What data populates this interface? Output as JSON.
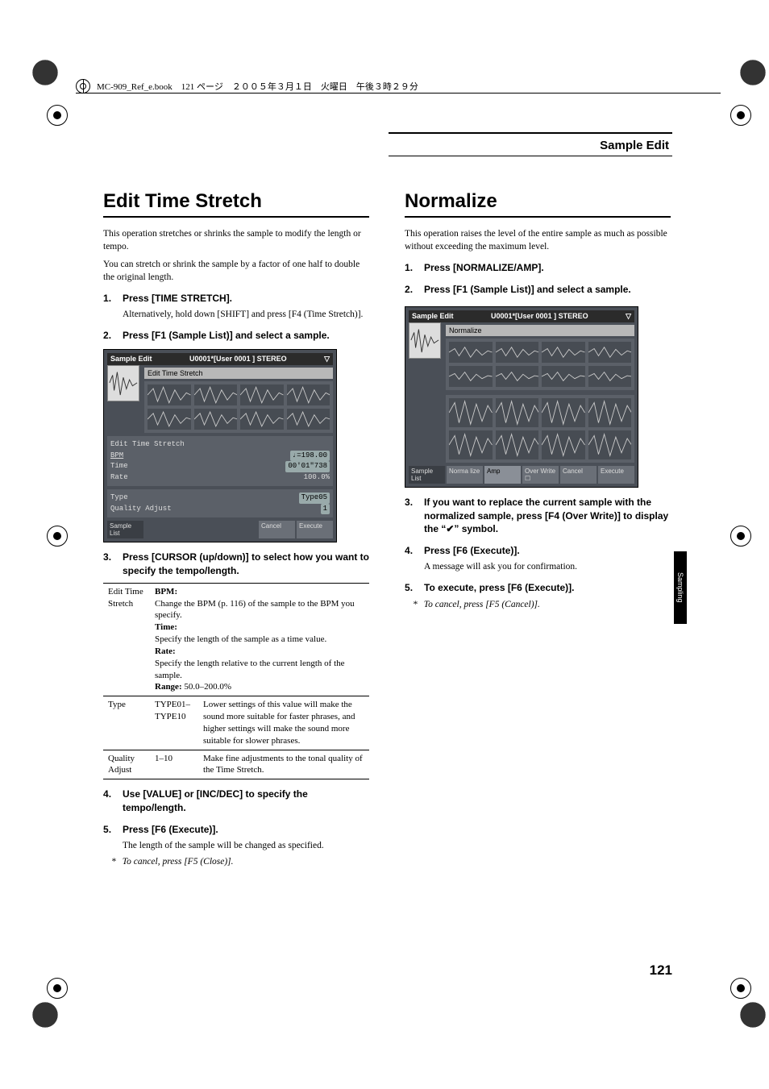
{
  "header": {
    "filebar": "MC-909_Ref_e.book　121 ページ　２００５年３月１日　火曜日　午後３時２９分"
  },
  "running_head": "Sample Edit",
  "side_tab": "Sampling",
  "page_number": "121",
  "left": {
    "title": "Edit Time Stretch",
    "intro_1": "This operation stretches or shrinks the sample to modify the length or tempo.",
    "intro_2": "You can stretch or shrink the sample by a factor of one half to double the original length.",
    "steps": {
      "1": "Press [TIME STRETCH].",
      "1_sub": "Alternatively, hold down [SHIFT] and press [F4 (Time Stretch)].",
      "2": "Press [F1 (Sample List)] and select a sample.",
      "3": "Press [CURSOR (up/down)] to select how you want to specify the tempo/length.",
      "4": "Use [VALUE] or [INC/DEC] to specify the tempo/length.",
      "5": "Press [F6 (Execute)].",
      "5_sub": "The length of the sample will be changed as specified.",
      "cancel": "To cancel, press [F5 (Close)]."
    },
    "screenshot": {
      "title_left": "Sample Edit",
      "title_mid": "U0001*[User 0001            ] STEREO",
      "subtitle": "Edit Time Stretch",
      "param_block_title": "Edit Time Stretch",
      "bpm_label": "BPM",
      "bpm_val": "♩=198.00",
      "time_label": "Time",
      "time_val": "00'01\"738",
      "rate_label": "Rate",
      "rate_val": "100.0%",
      "type_label": "Type",
      "type_val": "Type05",
      "qa_label": "Quality Adjust",
      "qa_val": "1",
      "sk1": "Sample List",
      "sk5": "Cancel",
      "sk6": "Execute"
    },
    "table": {
      "r1c1": "Edit Time Stretch",
      "r1c2_bpm": "BPM:",
      "r1c2_bpm_desc": "Change the BPM (p. 116) of the sample to the BPM you specify.",
      "r1c2_time": "Time:",
      "r1c2_time_desc": "Specify the length of the sample as a time value.",
      "r1c2_rate": "Rate:",
      "r1c2_rate_desc": "Specify the length relative to the current length of the sample.",
      "r1c2_range": "Range: ",
      "r1c2_range_val": "50.0–200.0%",
      "r2c1": "Type",
      "r2c2a": "TYPE01–TYPE10",
      "r2c2b": "Lower settings of this value will make the sound more suitable for faster phrases, and higher settings will make the sound more suitable for slower phrases.",
      "r3c1": "Quality Adjust",
      "r3c2a": "1–10",
      "r3c2b": "Make fine adjustments to the tonal quality of the Time Stretch."
    }
  },
  "right": {
    "title": "Normalize",
    "intro": "This operation raises the level of the entire sample as much as possible without exceeding the maximum level.",
    "steps": {
      "1": "Press [NORMALIZE/AMP].",
      "2": "Press [F1 (Sample List)] and select a sample.",
      "3": "If you want to replace the current sample with the normalized sample, press [F4 (Over Write)] to display the “✔” symbol.",
      "4": "Press [F6 (Execute)].",
      "4_sub": "A message will ask you for confirmation.",
      "5": "To execute, press [F6 (Execute)].",
      "cancel": "To cancel, press [F5 (Cancel)]."
    },
    "screenshot": {
      "title_left": "Sample Edit",
      "title_mid": "U0001*[User 0001            ] STEREO",
      "subtitle": "Normalize",
      "sk1": "Sample List",
      "sk2": "Norma lize",
      "sk3": "Amp",
      "sk4": "Over Write",
      "sk5": "Cancel",
      "sk6": "Execute"
    }
  }
}
